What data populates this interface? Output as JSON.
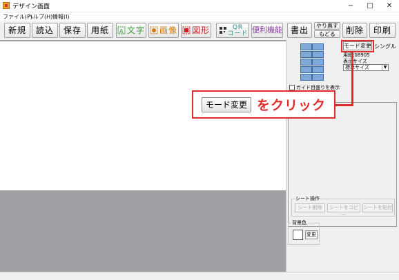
{
  "window": {
    "title": "デザイン画面",
    "min": "−",
    "max": "□",
    "close": "✕"
  },
  "menu": [
    "ファイル(F)",
    "ヘルプ(H)",
    "情報(I)"
  ],
  "toolbar": {
    "new": "新規",
    "read": "読込",
    "save": "保存",
    "paper": "用紙",
    "text": "文字",
    "image": "画像",
    "shape": "図形",
    "qr_line1": "QR",
    "qr_line2": "コード",
    "util": "便利機能",
    "output": "書出",
    "redo": "やり直す",
    "undo": "もどる",
    "delete": "削除",
    "print": "印刷"
  },
  "panel": {
    "mode_button": "モード変更",
    "single": "シングル",
    "paper_label": "用紙:08905",
    "display_size_label": "表示サイズ",
    "display_size_value": "標準サイズ",
    "guide_checkbox": "ガイド目盛りを表示",
    "sheet_ops_title": "シート操作",
    "sheet_delete": "シート削除",
    "sheet_copy": "シートをコピー",
    "sheet_paste": "シートを貼付",
    "bg_color_title": "背景色",
    "bg_change": "変更"
  },
  "callout": {
    "button": "モード変更",
    "text": "をクリック"
  },
  "colors": {
    "accent_red": "#e02b2b",
    "thumb_blue": "#7fa7d8",
    "canvas_gray": "#a0a0a4"
  }
}
